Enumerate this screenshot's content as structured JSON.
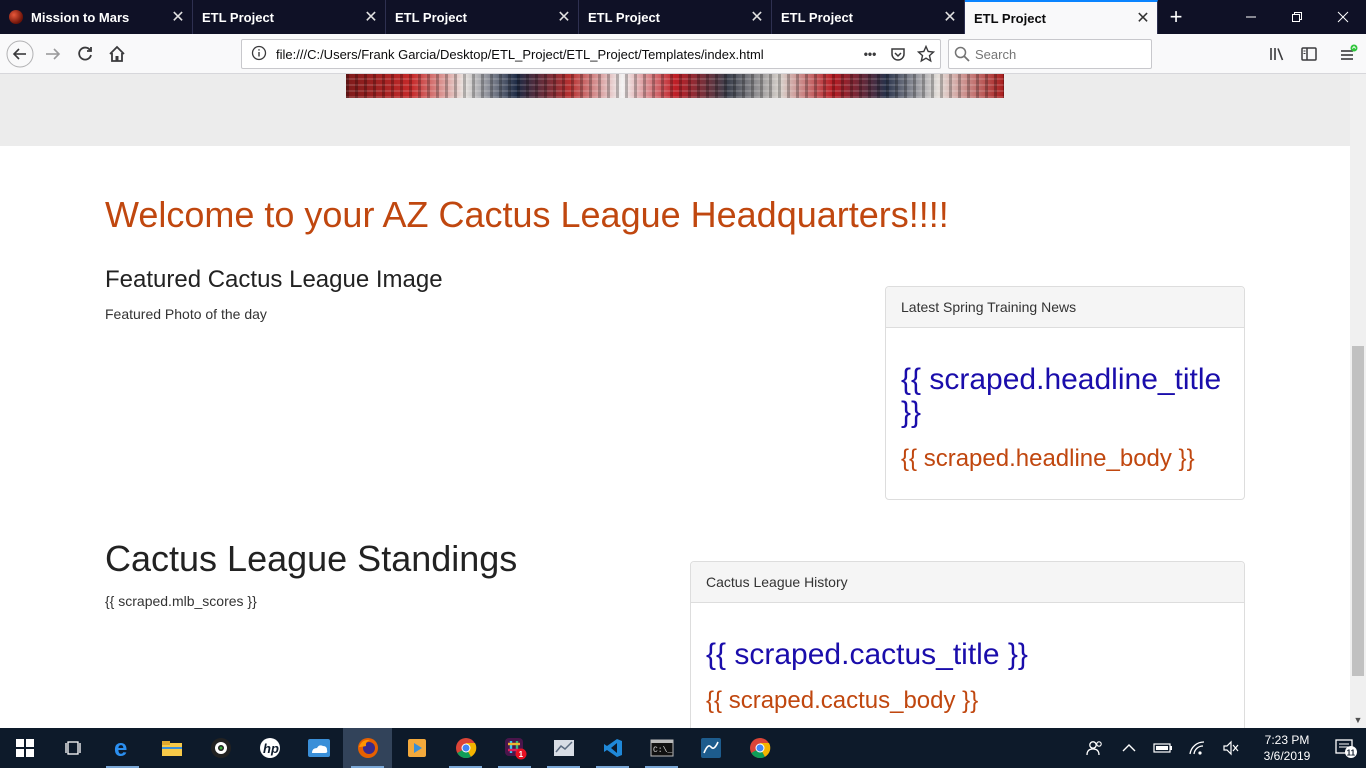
{
  "browser": {
    "tabs": [
      {
        "label": "Mission to Mars",
        "active": false,
        "has_favicon": true
      },
      {
        "label": "ETL Project",
        "active": false
      },
      {
        "label": "ETL Project",
        "active": false
      },
      {
        "label": "ETL Project",
        "active": false
      },
      {
        "label": "ETL Project",
        "active": false
      },
      {
        "label": "ETL Project",
        "active": true
      }
    ],
    "close_glyph": "✕",
    "new_tab_glyph": "+",
    "url": "file:///C:/Users/Frank Garcia/Desktop/ETL_Project/ETL_Project/Templates/index.html",
    "page_actions_glyph": "•••",
    "search_placeholder": "Search"
  },
  "page": {
    "welcome_heading": "Welcome to your AZ Cactus League Headquarters!!!!",
    "featured_heading": "Featured Cactus League Image",
    "featured_subtitle": "Featured Photo of the day",
    "standings_heading": "Cactus League Standings",
    "scores_placeholder": "{{ scraped.mlb_scores }}",
    "news_panel": {
      "header": "Latest Spring Training News",
      "title": "{{ scraped.headline_title }}",
      "body": "{{ scraped.headline_body }}"
    },
    "history_panel": {
      "header": "Cactus League History",
      "title": "{{ scraped.cactus_title }}",
      "body": "{{ scraped.cactus_body }}"
    }
  },
  "taskbar": {
    "apps": [
      "start-icon",
      "task-view-icon",
      "edge-icon",
      "file-explorer-icon",
      "webcam-app-icon",
      "hp-icon",
      "onedrive-icon",
      "firefox-icon",
      "media-player-icon",
      "chrome-icon",
      "slack-icon",
      "graph-app-icon",
      "vscode-icon",
      "terminal-icon",
      "mysql-workbench-icon",
      "chrome-icon"
    ],
    "slack_badge": "1",
    "time": "7:23 PM",
    "date": "3/6/2019",
    "notification_count": "11"
  },
  "colors": {
    "accent_heading": "#c0470f",
    "link_blue": "#1a0dab",
    "tabbar_bg": "#0f1126",
    "taskbar_bg": "#0d1a2a",
    "active_tab_line": "#0a84ff"
  }
}
